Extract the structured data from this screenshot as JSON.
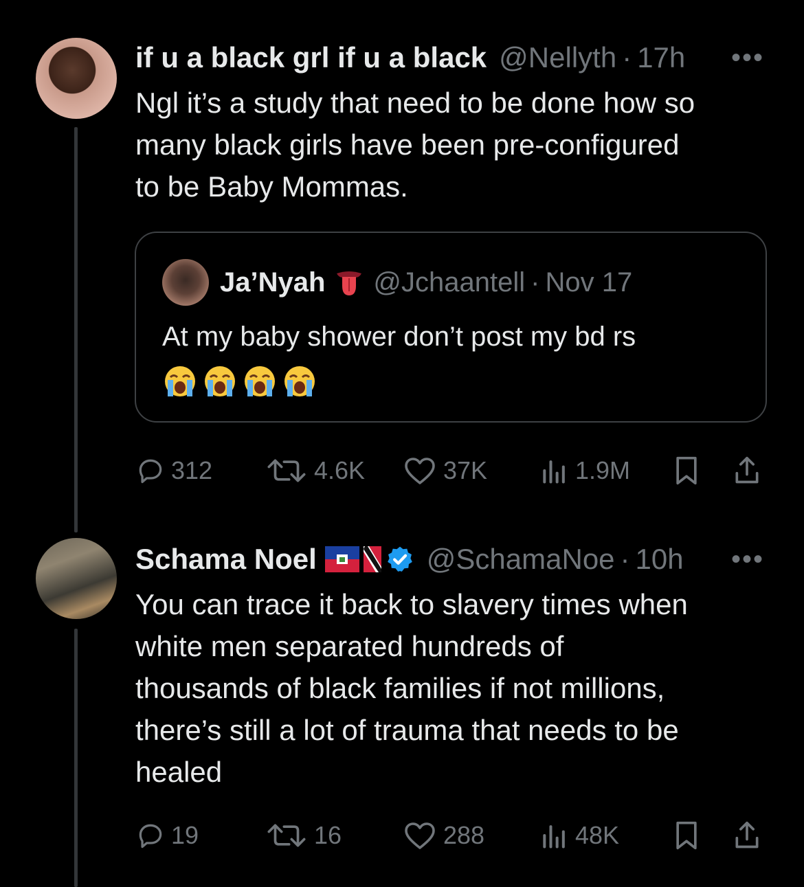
{
  "tweets": [
    {
      "name": "if u a black grl if u a black",
      "handle": "@Nellyth",
      "time": "17h",
      "text_lines": [
        "Ngl it’s a study that need to be done how so",
        "many black girls have been pre-configured",
        "to be Baby Mommas."
      ],
      "quote": {
        "name": "Ja’Nyah",
        "emoji": "tongue-emoji",
        "handle": "@Jchaantell",
        "date": "Nov 17",
        "text": "At my baby shower don’t post my bd rs",
        "trailing_emojis": [
          "crying-face-emoji",
          "crying-face-emoji",
          "crying-face-emoji",
          "crying-face-emoji"
        ]
      },
      "stats": {
        "replies": "312",
        "reposts": "4.6K",
        "likes": "37K",
        "views": "1.9M"
      }
    },
    {
      "name": "Schama Noel",
      "flags": [
        "haiti-flag",
        "trinidad-flag"
      ],
      "verified": true,
      "handle": "@SchamaNoe",
      "time": "10h",
      "text_lines": [
        "You can trace it back to slavery times when",
        "white men separated hundreds of",
        "thousands of black families if not millions,",
        "there’s still a lot of trauma that needs to be",
        "healed"
      ],
      "stats": {
        "replies": "19",
        "reposts": "16",
        "likes": "288",
        "views": "48K"
      }
    }
  ],
  "separator": "·",
  "more_label": "•••",
  "colors": {
    "background": "#000000",
    "text": "#e7e9ea",
    "muted": "#71767b",
    "border": "#3e4144",
    "verified": "#1d9bf0"
  }
}
